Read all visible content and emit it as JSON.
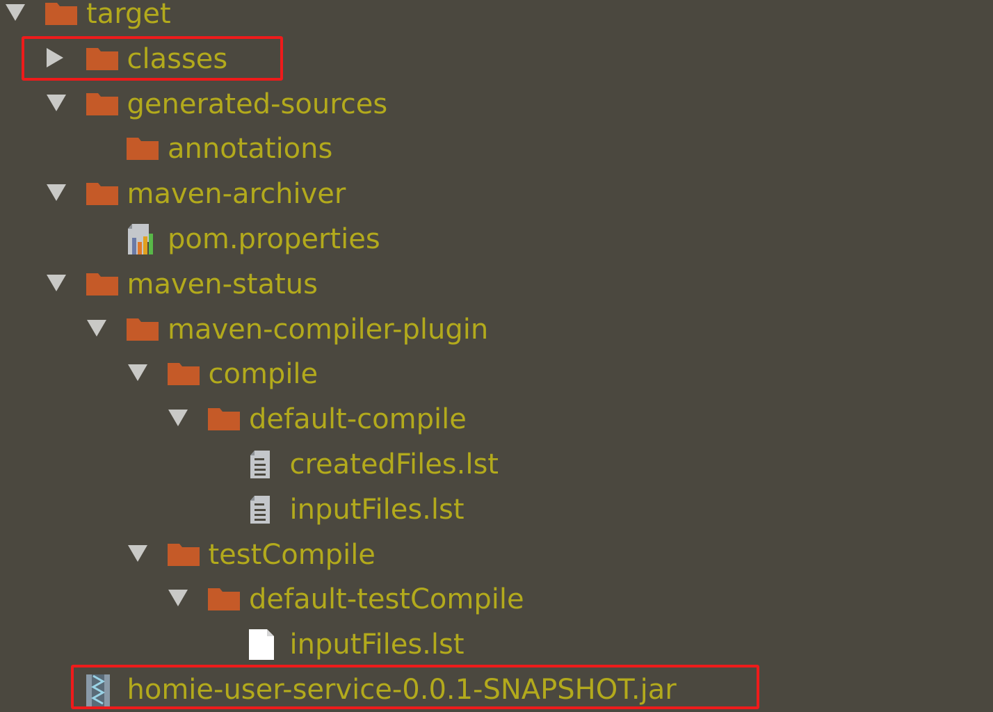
{
  "project_tree": {
    "items": [
      {
        "label": "target",
        "kind": "folder",
        "expand": "down",
        "depth": 0
      },
      {
        "label": "classes",
        "kind": "folder",
        "expand": "right",
        "depth": 1
      },
      {
        "label": "generated-sources",
        "kind": "folder",
        "expand": "down",
        "depth": 1
      },
      {
        "label": "annotations",
        "kind": "folder",
        "expand": "none",
        "depth": 2
      },
      {
        "label": "maven-archiver",
        "kind": "folder",
        "expand": "down",
        "depth": 1
      },
      {
        "label": "pom.properties",
        "kind": "properties-file",
        "expand": "none",
        "depth": 2
      },
      {
        "label": "maven-status",
        "kind": "folder",
        "expand": "down",
        "depth": 1
      },
      {
        "label": "maven-compiler-plugin",
        "kind": "folder",
        "expand": "down",
        "depth": 2
      },
      {
        "label": "compile",
        "kind": "folder",
        "expand": "down",
        "depth": 3
      },
      {
        "label": "default-compile",
        "kind": "folder",
        "expand": "down",
        "depth": 4
      },
      {
        "label": "createdFiles.lst",
        "kind": "text-file",
        "expand": "none",
        "depth": 5
      },
      {
        "label": "inputFiles.lst",
        "kind": "text-file",
        "expand": "none",
        "depth": 5
      },
      {
        "label": "testCompile",
        "kind": "folder",
        "expand": "down",
        "depth": 3
      },
      {
        "label": "default-testCompile",
        "kind": "folder",
        "expand": "down",
        "depth": 4
      },
      {
        "label": "inputFiles.lst",
        "kind": "blank-file",
        "expand": "none",
        "depth": 5
      },
      {
        "label": "homie-user-service-0.0.1-SNAPSHOT.jar",
        "kind": "jar-file",
        "expand": "none",
        "depth": 1
      }
    ]
  },
  "icons": {
    "folder": "folder-icon",
    "properties-file": "properties-file-icon",
    "text-file": "text-file-icon",
    "blank-file": "file-icon",
    "jar-file": "jar-archive-icon"
  },
  "colors": {
    "background": "#4b483f",
    "label": "#b3aa1c",
    "folder": "#c55a28",
    "highlight": "#ee1b1b"
  }
}
